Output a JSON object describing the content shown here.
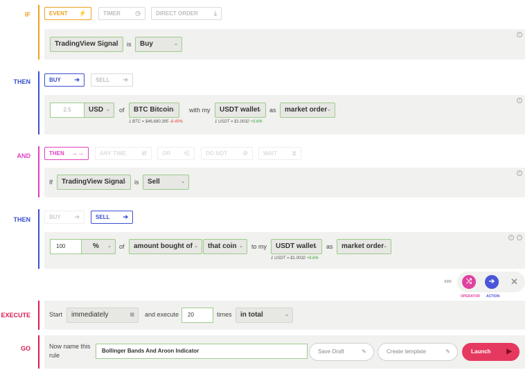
{
  "sections": {
    "if_label": "IF",
    "then1_label": "THEN",
    "and_label": "AND",
    "then2_label": "THEN",
    "execute_label": "EXECUTE",
    "go_label": "GO"
  },
  "if_tabs": {
    "event": "EVENT",
    "timer": "TIMER",
    "direct_order": "DIRECT ORDER"
  },
  "if_panel": {
    "signal": "TradingView Signal",
    "is": "is",
    "value": "Buy"
  },
  "then1": {
    "buy": "BUY",
    "sell": "SELL",
    "amount_placeholder": "2.5",
    "currency": "USD",
    "of": "of",
    "coin": "BTC Bitcoin",
    "with_my": "with my",
    "wallet": "USDT wallet",
    "as": "as",
    "order_type": "market order",
    "coin_rate": "1 BTC = $46,680.395",
    "coin_change": "-8.49%",
    "wallet_rate": "1 USDT = $1.0032",
    "wallet_change": "+9.6%"
  },
  "and_tabs": {
    "then": "THEN",
    "any_time": "ANY TIME",
    "or": "OR",
    "do_not": "DO NOT",
    "wait": "WAIT"
  },
  "and_panel": {
    "if": "If",
    "signal": "TradingView Signal",
    "is": "is",
    "value": "Sell"
  },
  "then2": {
    "buy": "BUY",
    "sell": "SELL",
    "amount": "100",
    "unit": "%",
    "of": "of",
    "target": "amount bought of",
    "coin": "that coin",
    "to_my": "to my",
    "wallet": "USDT wallet",
    "as": "as",
    "order_type": "market order",
    "wallet_rate": "1 USDT = $1.0032",
    "wallet_change": "+9.6%"
  },
  "add_bar": {
    "add": "ADD",
    "operator": "OPERATOR",
    "action": "ACTION"
  },
  "execute": {
    "start": "Start",
    "when": "immediately",
    "and_execute": "and execute",
    "count": "20",
    "times": "times",
    "scope": "in total"
  },
  "go": {
    "prompt_line1": "Now name this",
    "prompt_line2": "rule",
    "rule_name": "Bollinger Bands And Aroon Indicator",
    "save_draft": "Save Draft",
    "create_template": "Create template",
    "launch": "Launch"
  },
  "colors": {
    "if": "#f0a020",
    "then": "#3a4fd0",
    "and": "#e040c0",
    "execute": "#d81b50",
    "go": "#d81b50",
    "launch": "#e63960"
  }
}
